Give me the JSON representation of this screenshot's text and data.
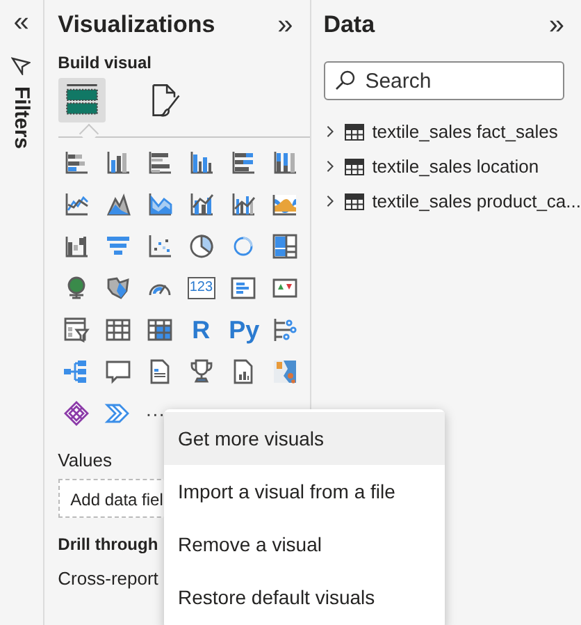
{
  "filters_pane": {
    "expand": "«",
    "label": "Filters"
  },
  "visualizations": {
    "title": "Visualizations",
    "collapse": "»",
    "section": "Build visual",
    "modes": [
      {
        "kind": "build",
        "selected": true
      },
      {
        "kind": "format",
        "selected": false
      }
    ],
    "visuals": [
      {
        "kind": "stacked-bar"
      },
      {
        "kind": "stacked-column"
      },
      {
        "kind": "clustered-bar"
      },
      {
        "kind": "clustered-column"
      },
      {
        "kind": "full-bar"
      },
      {
        "kind": "full-column"
      },
      {
        "kind": "line"
      },
      {
        "kind": "area"
      },
      {
        "kind": "stacked-area"
      },
      {
        "kind": "line-column"
      },
      {
        "kind": "line-clustered"
      },
      {
        "kind": "ribbon"
      },
      {
        "kind": "waterfall"
      },
      {
        "kind": "funnel"
      },
      {
        "kind": "scatter"
      },
      {
        "kind": "pie"
      },
      {
        "kind": "donut"
      },
      {
        "kind": "treemap"
      },
      {
        "kind": "globe"
      },
      {
        "kind": "filled-map"
      },
      {
        "kind": "gauge"
      },
      {
        "kind": "card",
        "label": "123"
      },
      {
        "kind": "multirow-card"
      },
      {
        "kind": "kpi"
      },
      {
        "kind": "slicer"
      },
      {
        "kind": "table"
      },
      {
        "kind": "matrix"
      },
      {
        "kind": "text",
        "label": "R"
      },
      {
        "kind": "text",
        "label": "Py"
      },
      {
        "kind": "influencers"
      },
      {
        "kind": "tree"
      },
      {
        "kind": "speech"
      },
      {
        "kind": "document"
      },
      {
        "kind": "trophy"
      },
      {
        "kind": "report"
      },
      {
        "kind": "azure-map"
      },
      {
        "kind": "power-apps"
      },
      {
        "kind": "power-automate"
      },
      {
        "kind": "more",
        "label": "···"
      }
    ],
    "values_label": "Values",
    "values_field": "Add data fiel",
    "drill_label": "Drill through",
    "cross_report": "Cross-report"
  },
  "data": {
    "title": "Data",
    "collapse": "»",
    "search": {
      "placeholder": "Search"
    },
    "tables": [
      {
        "name": "textile_sales fact_sales",
        "expanded": false
      },
      {
        "name": "textile_sales location",
        "expanded": false
      },
      {
        "name": "textile_sales product_ca...",
        "expanded": false
      }
    ]
  },
  "menu": [
    {
      "label": "Get more visuals",
      "selected": true
    },
    {
      "label": "Import a visual from a file",
      "selected": false
    },
    {
      "label": "Remove a visual",
      "selected": false
    },
    {
      "label": "Restore default visuals",
      "selected": false
    }
  ]
}
